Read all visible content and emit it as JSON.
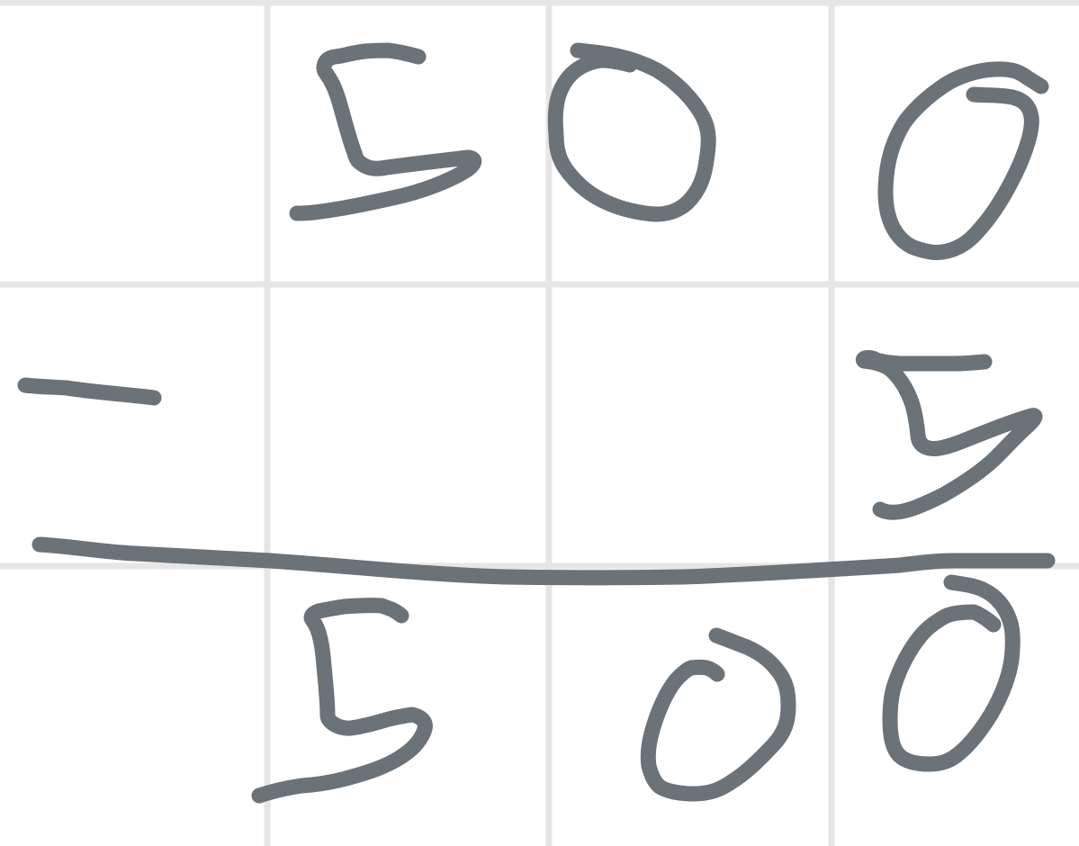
{
  "worksheet": {
    "grid": {
      "rows": 3,
      "columns": 4
    },
    "colors": {
      "background": "#ffffff",
      "grid_line": "#e6e6e6",
      "ink": "#6b7278"
    },
    "problem": {
      "minuend": "500",
      "operator": "-",
      "subtrahend": "5",
      "result": "500"
    }
  }
}
